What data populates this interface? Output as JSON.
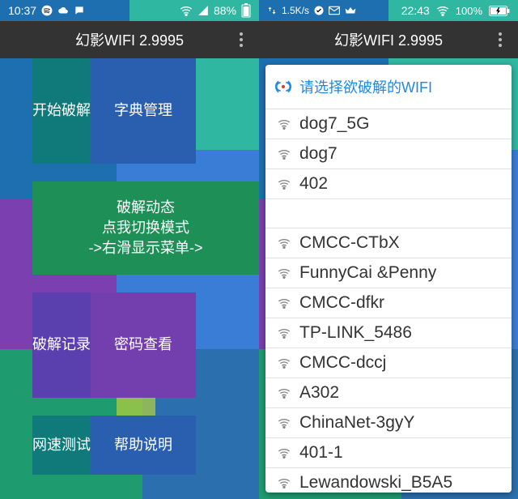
{
  "left": {
    "status": {
      "time": "10:37",
      "battery": "88%"
    },
    "appbar": {
      "title": "幻影WIFI 2.9995"
    },
    "tiles": {
      "start_crack": "开始破解",
      "dict_manage": "字典管理",
      "mode_line1": "破解动态",
      "mode_line2": "点我切换模式",
      "mode_line3": "->右滑显示菜单->",
      "crack_records": "破解记录",
      "password_view": "密码查看",
      "speed_test": "网速测试",
      "help": "帮助说明"
    }
  },
  "right": {
    "status": {
      "speed": "1.5K/s",
      "time": "22:43",
      "battery": "100%"
    },
    "appbar": {
      "title": "幻影WIFI 2.9995"
    },
    "dialog": {
      "header": "请选择欲破解的WIFI",
      "items": [
        "dog7_5G",
        "dog7",
        "402",
        "",
        "CMCC-CTbX",
        "FunnyCai &Penny",
        "CMCC-dfkr",
        "TP-LINK_5486",
        "CMCC-dccj",
        "A302",
        "ChinaNet-3gyY",
        "401-1",
        "Lewandowski_B5A5"
      ]
    }
  }
}
